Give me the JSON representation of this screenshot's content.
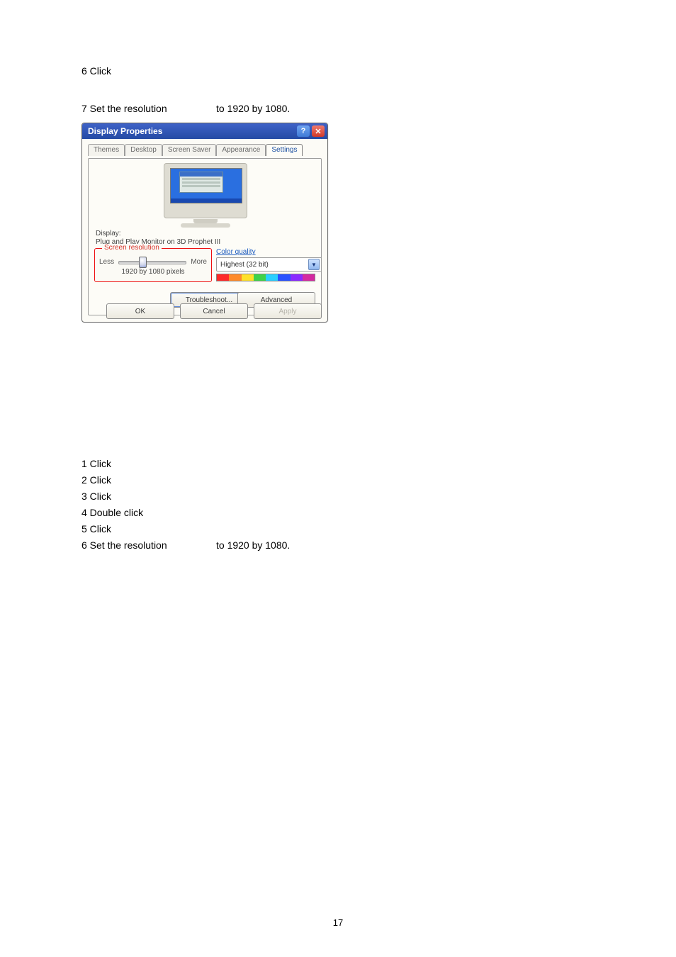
{
  "page_number": "17",
  "instructions_top": [
    "6 Click",
    "7 Set the resolution",
    "to 1920 by 1080."
  ],
  "instructions_bottom": [
    "1 Click",
    "2 Click",
    "3 Click",
    "4 Double click",
    "5 Click",
    "6 Set the resolution",
    "to 1920 by 1080."
  ],
  "dp": {
    "title": "Display Properties",
    "help_glyph": "?",
    "close_glyph": "✕",
    "tabs": [
      "Themes",
      "Desktop",
      "Screen Saver",
      "Appearance",
      "Settings"
    ],
    "active_tab": "Settings",
    "display_label": "Display:",
    "display_value": "Plug and Play Monitor on 3D Prophet III",
    "screen_resolution": {
      "legend": "Screen resolution",
      "less": "Less",
      "more": "More",
      "value": "1920 by 1080 pixels"
    },
    "color_quality": {
      "legend": "Color quality",
      "selected": "Highest (32 bit)",
      "swatch": [
        "#ff2a2a",
        "#ff8a2a",
        "#ffe12a",
        "#3fd24a",
        "#2acfff",
        "#2a52ff",
        "#8a2aff",
        "#d42aa0"
      ]
    },
    "buttons": {
      "troubleshoot": "Troubleshoot...",
      "advanced": "Advanced",
      "ok": "OK",
      "cancel": "Cancel",
      "apply": "Apply"
    }
  }
}
